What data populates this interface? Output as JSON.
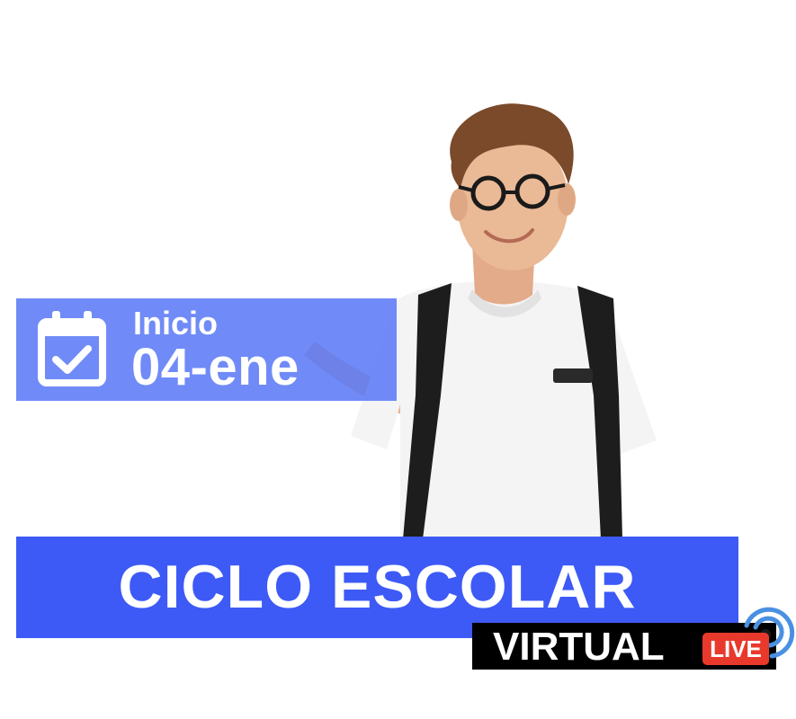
{
  "start": {
    "label": "Inicio",
    "date": "04-ene",
    "icon": "calendar-check-icon"
  },
  "title": "CICLO ESCOLAR",
  "modality": {
    "label": "VIRTUAL",
    "badge": "LIVE",
    "icon": "broadcast-icon"
  },
  "colors": {
    "start_box": "#5878f6",
    "title_band": "#3d5af6",
    "virtual_band": "#000000",
    "live_badge": "#e8392c",
    "broadcast": "#4a90e2"
  }
}
